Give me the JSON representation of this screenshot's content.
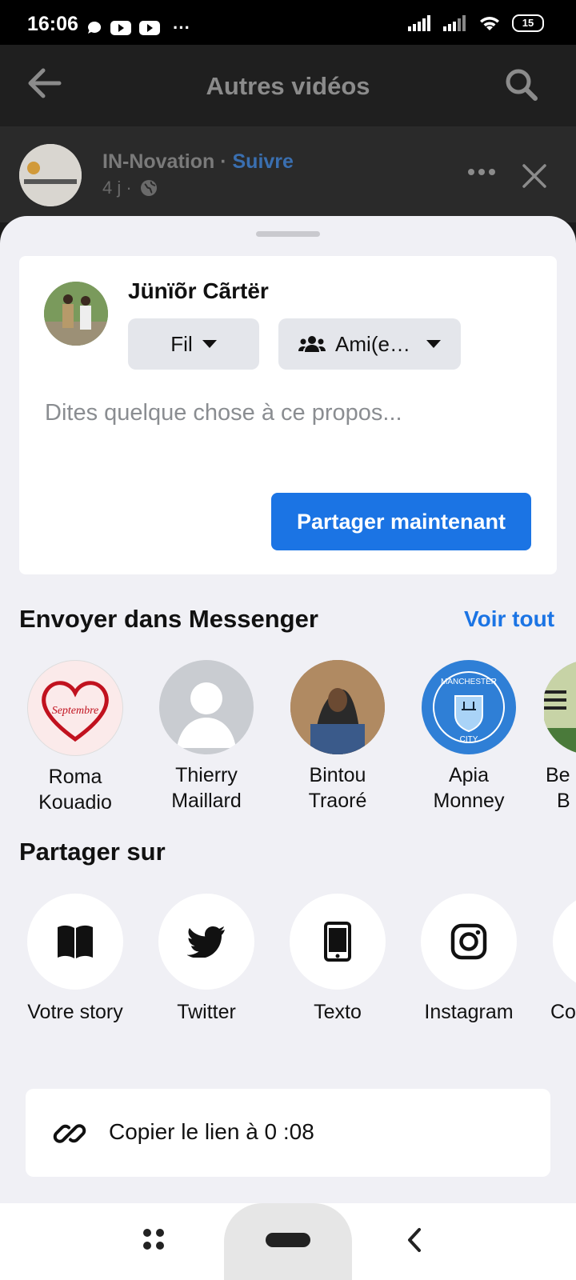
{
  "status_bar": {
    "time": "16:06",
    "extra": "···",
    "battery": "15"
  },
  "header": {
    "title": "Autres vidéos"
  },
  "post": {
    "page_name": "IN-Novation",
    "dot": " · ",
    "follow": "Suivre",
    "time": "4 j ·"
  },
  "composer": {
    "user_name": "Jünïõr Cãrtër",
    "feed_label": "Fil",
    "audience_label": "Ami(e…",
    "placeholder": "Dites quelque chose à ce propos...",
    "share_label": "Partager maintenant"
  },
  "messenger": {
    "title": "Envoyer dans Messenger",
    "see_all": "Voir tout",
    "contacts": [
      {
        "line1": "Roma",
        "line2": "Kouadio"
      },
      {
        "line1": "Thierry",
        "line2": "Maillard"
      },
      {
        "line1": "Bintou",
        "line2": "Traoré"
      },
      {
        "line1": "Apia",
        "line2": "Monney"
      },
      {
        "line1": "Be",
        "line2": "B"
      }
    ],
    "avatar_texts": {
      "septembre": "Septembre",
      "city": "CITY",
      "manchester": "MANCHESTER"
    }
  },
  "share_on": {
    "title": "Partager sur",
    "options": [
      {
        "label": "Votre story",
        "icon": "book-icon"
      },
      {
        "label": "Twitter",
        "icon": "twitter-icon"
      },
      {
        "label": "Texto",
        "icon": "phone-icon"
      },
      {
        "label": "Instagram",
        "icon": "instagram-icon"
      },
      {
        "label": "Co",
        "icon": "partial-icon"
      }
    ]
  },
  "copy_link": {
    "label": "Copier le lien à 0 :08"
  },
  "colors": {
    "accent": "#1b74e4",
    "sheet_bg": "#f0f0f5"
  }
}
